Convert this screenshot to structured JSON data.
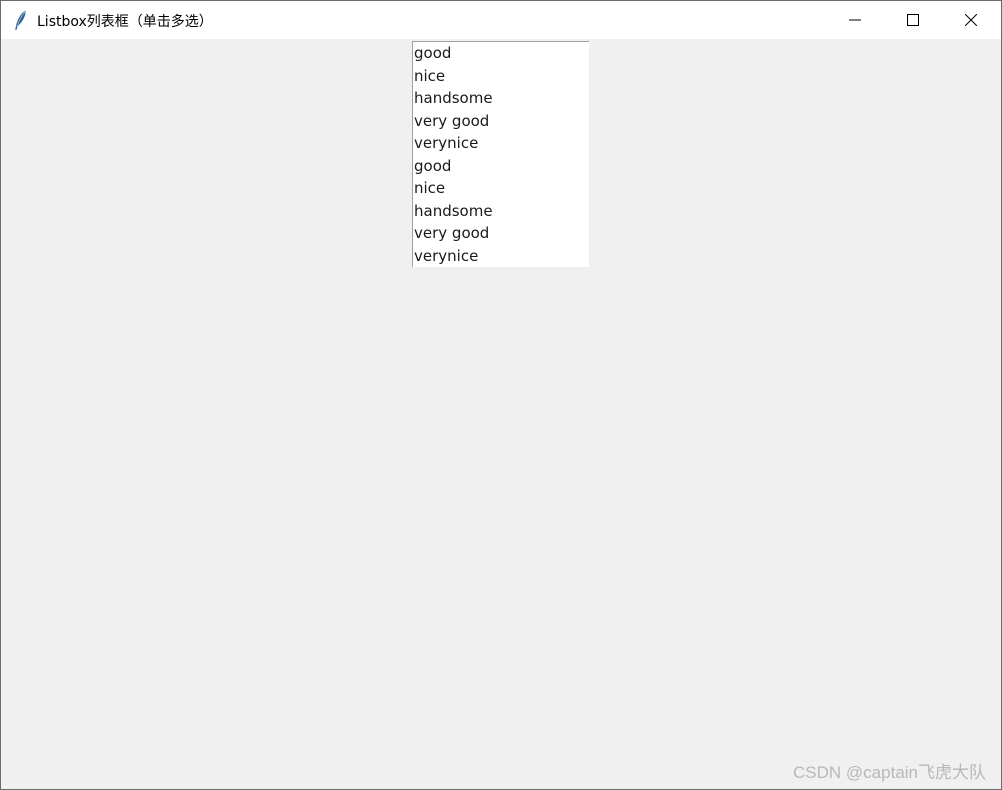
{
  "window": {
    "title": "Listbox列表框（单击多选）"
  },
  "listbox": {
    "items": [
      {
        "label": "good"
      },
      {
        "label": "nice"
      },
      {
        "label": "handsome"
      },
      {
        "label": "very good"
      },
      {
        "label": "verynice"
      },
      {
        "label": "good"
      },
      {
        "label": "nice"
      },
      {
        "label": "handsome"
      },
      {
        "label": "very good"
      },
      {
        "label": "verynice"
      }
    ]
  },
  "watermark": {
    "text": "CSDN @captain飞虎大队"
  },
  "icons": {
    "app": "feather-icon",
    "minimize": "minimize-icon",
    "maximize": "maximize-icon",
    "close": "close-icon"
  }
}
